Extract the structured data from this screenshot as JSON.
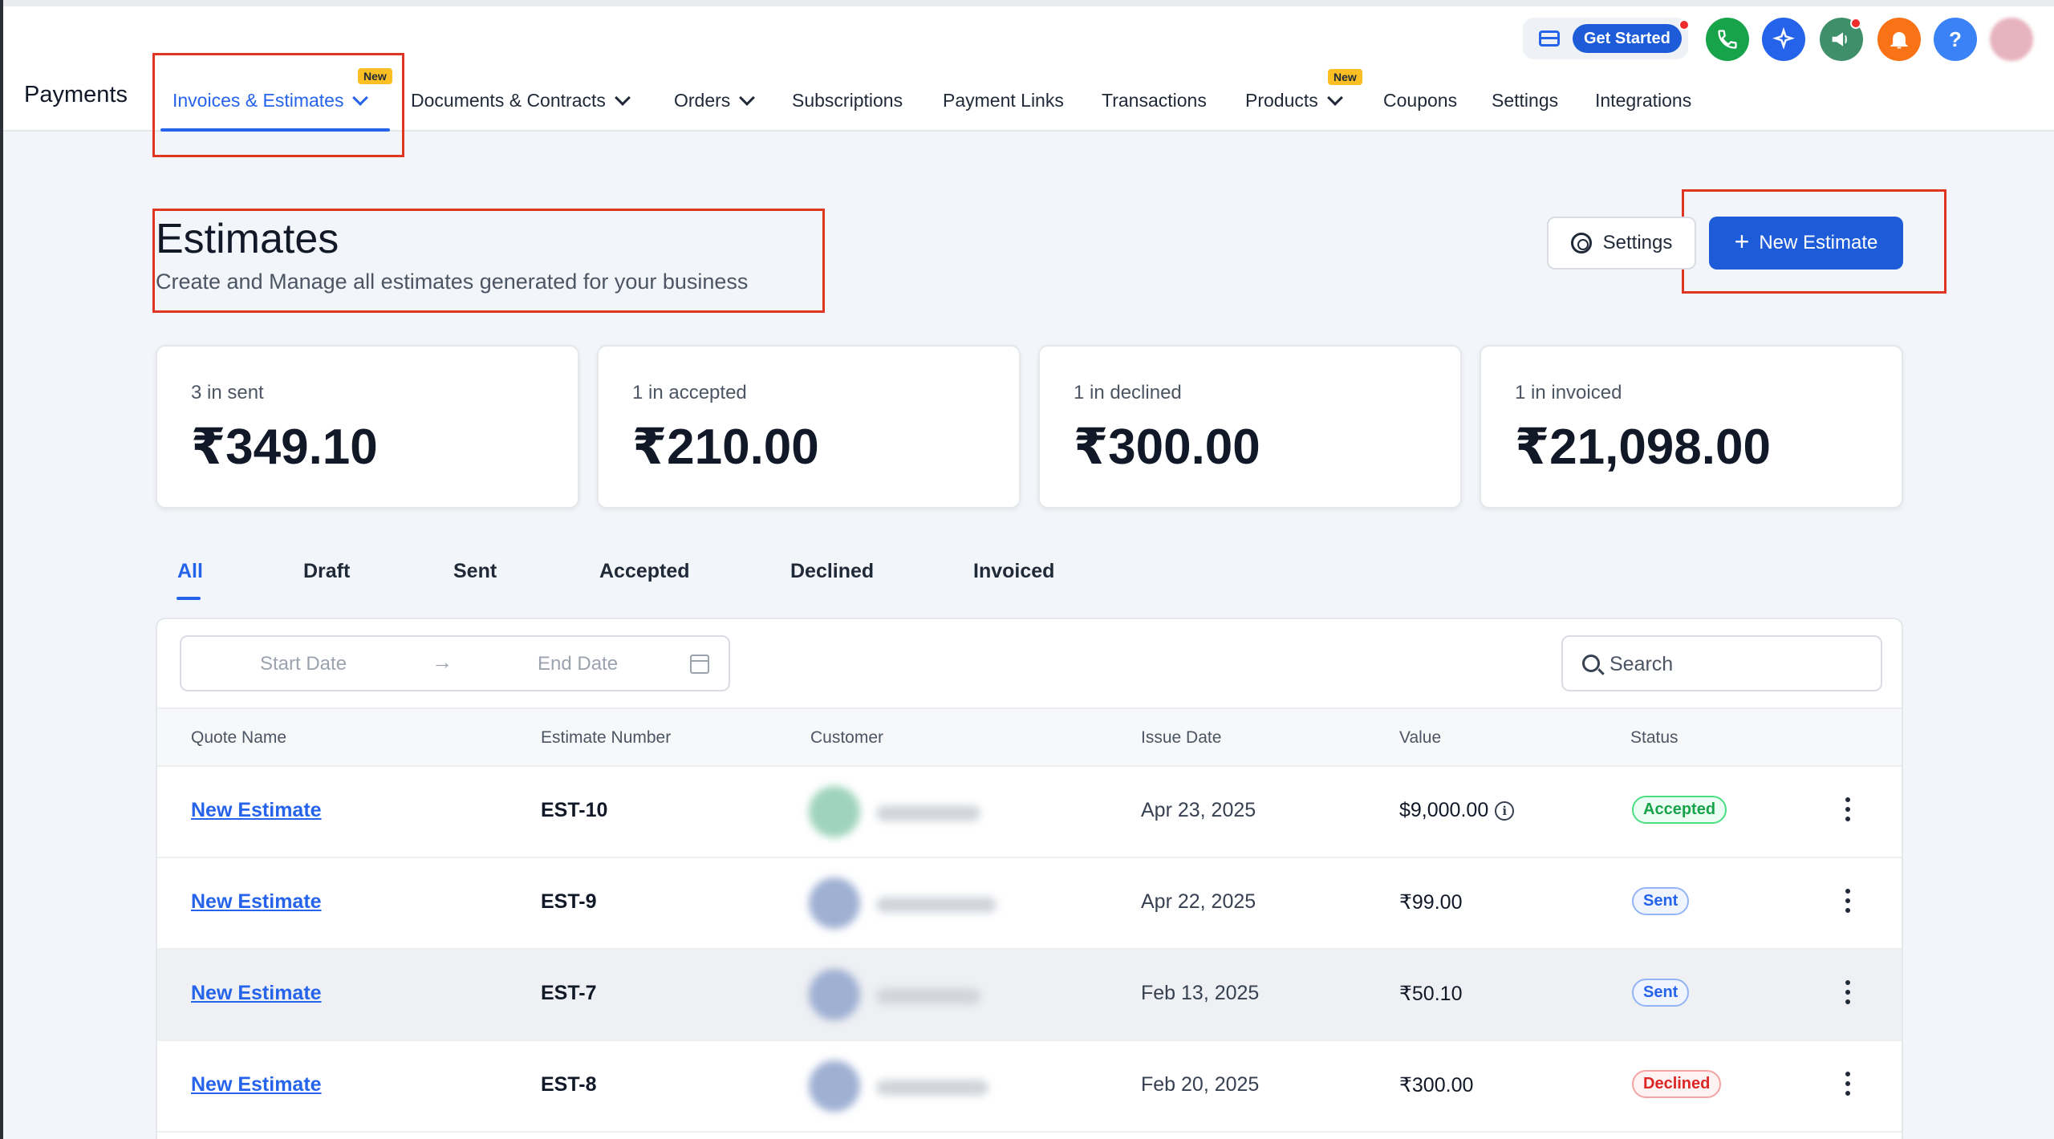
{
  "app": {
    "title": "Payments"
  },
  "nav": {
    "items": [
      {
        "label": "Invoices & Estimates",
        "badge": "New",
        "active": true,
        "dropdown": true
      },
      {
        "label": "Documents & Contracts",
        "dropdown": true
      },
      {
        "label": "Orders",
        "dropdown": true
      },
      {
        "label": "Subscriptions"
      },
      {
        "label": "Payment Links"
      },
      {
        "label": "Transactions"
      },
      {
        "label": "Products",
        "badge": "New",
        "dropdown": true
      },
      {
        "label": "Coupons"
      },
      {
        "label": "Settings"
      },
      {
        "label": "Integrations"
      }
    ],
    "get_started_label": "Get Started",
    "help_symbol": "?"
  },
  "header": {
    "title": "Estimates",
    "subtitle": "Create and Manage all estimates generated for your business",
    "settings_label": "Settings",
    "new_estimate_label": "New Estimate"
  },
  "stats": [
    {
      "label": "3 in sent",
      "value": "₹349.10"
    },
    {
      "label": "1 in accepted",
      "value": "₹210.00"
    },
    {
      "label": "1 in declined",
      "value": "₹300.00"
    },
    {
      "label": "1 in invoiced",
      "value": "₹21,098.00"
    }
  ],
  "tabs": [
    "All",
    "Draft",
    "Sent",
    "Accepted",
    "Declined",
    "Invoiced"
  ],
  "filters": {
    "start_date_placeholder": "Start Date",
    "end_date_placeholder": "End Date",
    "search_placeholder": "Search"
  },
  "table": {
    "columns": [
      "Quote Name",
      "Estimate Number",
      "Customer",
      "Issue Date",
      "Value",
      "Status"
    ],
    "rows": [
      {
        "quote_name": "New Estimate",
        "estimate_number": "EST-10",
        "issue_date": "Apr 23, 2025",
        "value": "$9,000.00",
        "status": "Accepted"
      },
      {
        "quote_name": "New Estimate",
        "estimate_number": "EST-9",
        "issue_date": "Apr 22, 2025",
        "value": "₹99.00",
        "status": "Sent"
      },
      {
        "quote_name": "New Estimate",
        "estimate_number": "EST-7",
        "issue_date": "Feb 13, 2025",
        "value": "₹50.10",
        "status": "Sent"
      },
      {
        "quote_name": "New Estimate",
        "estimate_number": "EST-8",
        "issue_date": "Feb 20, 2025",
        "value": "₹300.00",
        "status": "Declined"
      }
    ]
  },
  "colors": {
    "accent": "#2563eb",
    "primary_button": "#1d5bd8",
    "highlight_outline": "#e03522",
    "status_accepted": "#16a34a",
    "status_sent": "#2563eb",
    "status_declined": "#dc2626"
  },
  "icons": [
    "card-icon",
    "phone-icon",
    "sparkle-icon",
    "megaphone-icon",
    "bell-icon",
    "help-icon",
    "gear-icon",
    "plus-icon",
    "arrow-right-icon",
    "calendar-icon",
    "search-icon",
    "info-icon",
    "more-vertical-icon"
  ]
}
